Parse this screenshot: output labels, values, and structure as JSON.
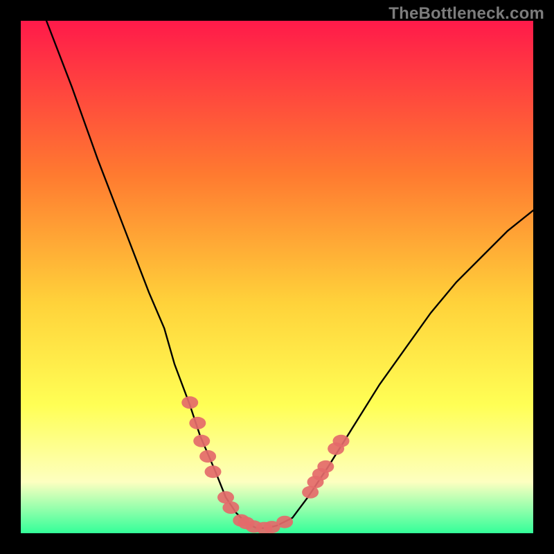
{
  "watermark": "TheBottleneck.com",
  "colors": {
    "bg": "#000000",
    "grad_top": "#ff1a4a",
    "grad_mid1": "#ff7a30",
    "grad_mid2": "#ffd23a",
    "grad_mid3": "#ffff55",
    "grad_mid4": "#fdffc0",
    "grad_bottom": "#33ff99",
    "curve": "#000000",
    "marker_fill": "#e46a6a",
    "marker_stroke": "#c94f4f"
  },
  "chart_data": {
    "type": "line",
    "title": "",
    "xlabel": "",
    "ylabel": "",
    "xlim": [
      0,
      100
    ],
    "ylim": [
      0,
      100
    ],
    "series": [
      {
        "name": "bottleneck-curve",
        "x": [
          5,
          10,
          15,
          20,
          25,
          28,
          30,
          33,
          35,
          38,
          40,
          42,
          44,
          46,
          48,
          50,
          53,
          56,
          60,
          65,
          70,
          75,
          80,
          85,
          90,
          95,
          100
        ],
        "y": [
          100,
          87,
          73,
          60,
          47,
          40,
          33,
          25,
          19,
          12,
          7,
          4,
          2,
          1,
          1,
          1.5,
          3,
          7,
          13,
          21,
          29,
          36,
          43,
          49,
          54,
          59,
          63
        ]
      }
    ],
    "markers": [
      {
        "x": 33.0,
        "y": 25.5
      },
      {
        "x": 34.5,
        "y": 21.5
      },
      {
        "x": 35.3,
        "y": 18.0
      },
      {
        "x": 36.5,
        "y": 15.0
      },
      {
        "x": 37.5,
        "y": 12.0
      },
      {
        "x": 40.0,
        "y": 7.0
      },
      {
        "x": 41.0,
        "y": 5.0
      },
      {
        "x": 43.0,
        "y": 2.5
      },
      {
        "x": 44.0,
        "y": 2.0
      },
      {
        "x": 45.5,
        "y": 1.3
      },
      {
        "x": 47.5,
        "y": 1.0
      },
      {
        "x": 49.0,
        "y": 1.2
      },
      {
        "x": 51.5,
        "y": 2.2
      },
      {
        "x": 56.5,
        "y": 8.0
      },
      {
        "x": 57.5,
        "y": 10.0
      },
      {
        "x": 58.5,
        "y": 11.5
      },
      {
        "x": 59.5,
        "y": 13.0
      },
      {
        "x": 61.5,
        "y": 16.5
      },
      {
        "x": 62.5,
        "y": 18.0
      }
    ]
  }
}
